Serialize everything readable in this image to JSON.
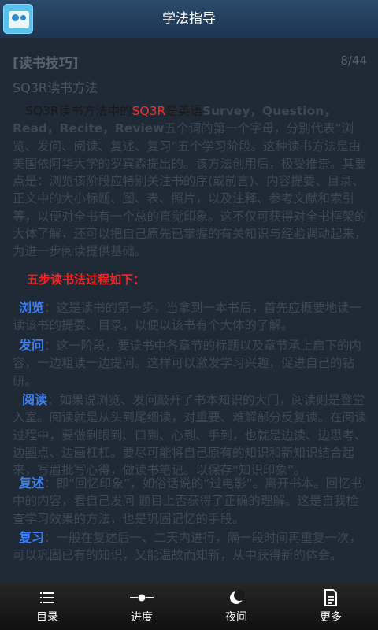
{
  "header": {
    "title": "学法指导",
    "app_icon": "book-icon"
  },
  "content": {
    "section": "[读书技巧]",
    "page_indicator": "8/44",
    "subtitle": "SQ3R读书方法",
    "intro": {
      "lead": "SQ3R读书方法中的",
      "highlight": "SQ3R",
      "mid": "是英语",
      "words": "Survey，Question，Read，Recite，Review",
      "rest": "五个词的第一个字母，分别代表“浏览、发问、阅读、复述、复习”五个学习阶段。这种读书方法是由美国依阿华大学的罗宾森提出的。该方法创用后，极受推崇。其要点是：浏览该阶段应特别关注书的序(或前言)、内容提要、目录、正文中的大小标题、图、表、照片，以及注释、参考文献和索引等，以便对全书有一个总的直觉印象。这不仅可获得对全书框架的大体了解，还可以把自己原先已掌握的有关知识与经验调动起来，为进一步阅读提供基础。"
    },
    "steps_title": "五步读书法过程如下：",
    "steps": [
      {
        "label": "浏览",
        "text": "：这是读书的第一步，当拿到一本书后，首先应概要地读一读该书的提要、目录，以便以该书有个大体的了解。"
      },
      {
        "label": "发问",
        "text": "：这一阶段，要读书中各章节的标题以及章节承上启下的内容，一边粗读一边提问。这样可以激发学习兴趣，促进自己的钻研。"
      },
      {
        "label": "阅读",
        "text": "：如果说浏览、发问敲开了书本知识的大门，阅读则是登堂入室。阅读就是从头到尾细读，对重要、难解部分反复读。在阅读过程中，要做到眼到、口到、心到、手到，也就是边读、边思考、边圈点、边画杠杠。要尽可能将自己原有的知识和新知识结合起来，写眉批写心得，做读书笔记。以保存“知识印象”。"
      },
      {
        "label": "复述",
        "text": "：即“回忆印象”，如俗话说的“过电影”。离开书本。回忆书中的内容，看自己发问 题目上否获得了正确的理解。这是自我检查学习效果的方法，也是巩固记忆的手段。"
      },
      {
        "label": "复习",
        "text": "：一般在复述后一、二天内进行，隔一段时间再重复一次，可以巩固已有的知识，又能温故而知新，从中获得新的体会。"
      }
    ]
  },
  "bottom_nav": [
    {
      "label": "目录",
      "icon": "list-icon"
    },
    {
      "label": "进度",
      "icon": "progress-slider-icon"
    },
    {
      "label": "夜间",
      "icon": "moon-icon"
    },
    {
      "label": "更多",
      "icon": "document-icon"
    }
  ],
  "colors": {
    "titlebar": "#23405f",
    "background": "#1f2a36",
    "step_label": "#3d7ff2",
    "highlight": "#ff2a22"
  }
}
